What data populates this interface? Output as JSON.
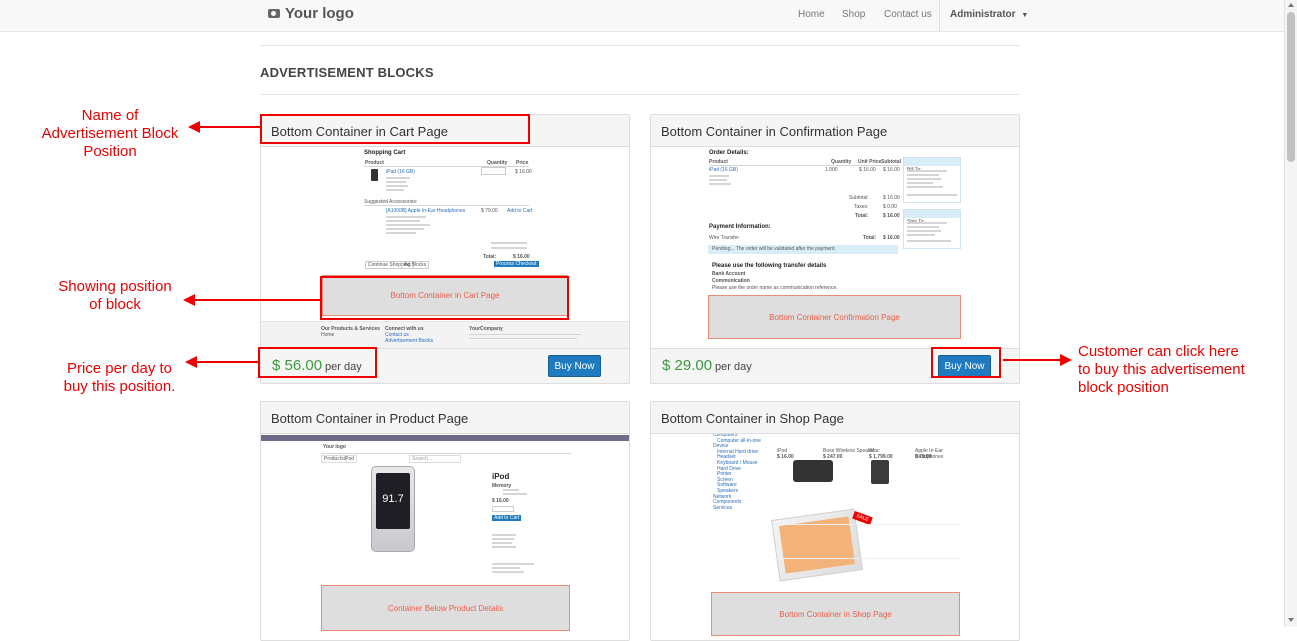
{
  "nav": {
    "logo": "Your logo",
    "links": [
      "Home",
      "Shop",
      "Contact us"
    ],
    "user": "Administrator"
  },
  "page": {
    "heading": "ADVERTISEMENT BLOCKS"
  },
  "cards": [
    {
      "title": "Bottom Container in Cart Page",
      "price": "$ 56.00",
      "per_day": "per day",
      "button": "Buy Now",
      "ad_label": "Bottom Container in Cart Page",
      "preview": {
        "title": "Shopping Cart",
        "cols": [
          "Product",
          "Quantity",
          "Price"
        ],
        "item": "iPad (16 GB)",
        "item_price": "$ 16.00",
        "accessories": "Suggested Accessories:",
        "accessory_name": "[A1000B] Apple In-Ear Headphones",
        "accessory_price": "$ 79.00",
        "add_to_cart": "Add to Cart",
        "total_label": "Total:",
        "total": "$ 16.00",
        "continue": "Continue Shopping",
        "ad_blocks": "Ad Blocks",
        "checkout": "Process Checkout",
        "footer_cols": [
          "Our Products & Services",
          "Connect with us",
          "YourCompany"
        ],
        "footer_links": [
          "Home",
          "Contact us",
          "Advertisement Blocks"
        ]
      }
    },
    {
      "title": "Bottom Container in Confirmation Page",
      "price": "$ 29.00",
      "per_day": "per day",
      "button": "Buy Now",
      "ad_label": "Bottom Container Confirmation Page",
      "preview": {
        "order_title": "Order Details:",
        "cols": [
          "Product",
          "Quantity",
          "Unit Price",
          "Subtotal"
        ],
        "item": "iPad (16 GB)",
        "item_qty": "1.000",
        "item_unit": "$ 16.00",
        "item_sub": "$ 16.00",
        "subtotal_label": "Subtotal:",
        "taxes_label": "Taxes:",
        "total_label": "Total:",
        "subtotal": "$ 16.00",
        "taxes": "$ 0.00",
        "total": "$ 16.00",
        "bill_to": "Bill To:",
        "ship_to": "Ship To:",
        "payment_title": "Payment Information:",
        "payment_method": "Wire Transfer",
        "pending": "Pending... The order will be validated after the payment.",
        "transfer_title": "Please use the following transfer details",
        "bank": "Bank Account",
        "communication": "Communication",
        "reference": "Please use the order name as communication reference."
      }
    },
    {
      "title": "Bottom Container in Product Page",
      "ad_label": "Container Below Product Details",
      "preview": {
        "logo": "Your logo",
        "product": "iPod",
        "screen": "91.7",
        "memory": "Memory",
        "price": "$ 16.00",
        "add_to_cart": "Add to Cart",
        "crumbs": [
          "Products",
          "iPod"
        ],
        "search": "Search..."
      }
    },
    {
      "title": "Bottom Container in Shop Page",
      "ad_label": "Bottom Container in Shop Page",
      "preview": {
        "products": [
          "iPod",
          "Bose Wireless Speaker",
          "iMac",
          "Apple In-Ear Headphones"
        ],
        "prices": [
          "$ 16.00",
          "$ 247.00",
          "$ 1,799.00",
          "$ 79.00"
        ],
        "categories": [
          "Computers",
          "Computer all-in-one",
          "Device",
          "Internal Hard drive",
          "Headset",
          "Keyboard / Mouse",
          "Hard Drive",
          "Printer",
          "Screen",
          "Software",
          "Speakers",
          "Network",
          "Components",
          "Services"
        ],
        "sale": "SALE"
      }
    }
  ],
  "annotations": {
    "name": "Name of\nAdvertisement Block\nPosition",
    "position": "Showing position\nof block",
    "price": "Price per day to\nbuy this position.",
    "buy": "Customer can click here\nto buy this advertisement\nblock position"
  },
  "colors": {
    "price": "#3c9a3c",
    "button": "#1f7ac0",
    "annotation": "#ee0000"
  }
}
